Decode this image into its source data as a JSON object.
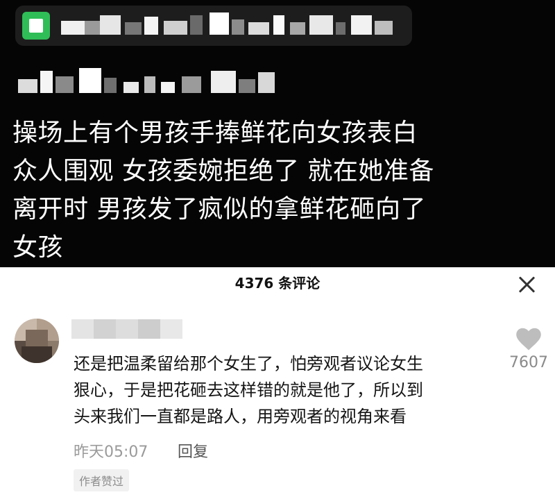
{
  "post": {
    "text_lines": [
      "操场上有个男孩手捧鲜花向女孩表白",
      "众人围观 女孩委婉拒绝了 就在她准备",
      "离开时 男孩发了疯似的拿鲜花砸向了",
      "女孩"
    ]
  },
  "comments_sheet": {
    "count_label": "4376 条评论",
    "comment": {
      "lines": [
        "还是把温柔留给那个女生了，怕旁观者议论女生",
        "狠心，于是把花砸去这样错的就是他了，所以到",
        "头来我们一直都是路人，用旁观者的视角来看"
      ],
      "time": "昨天05:07",
      "reply_label": "回复",
      "badge": "作者赞过",
      "like_count": "7607"
    }
  },
  "icons": {
    "close": "close-icon",
    "like": "heart-icon",
    "app": "app-logo-icon"
  },
  "colors": {
    "post_background": "#050505",
    "app_logo": "#2fbd57",
    "sheet_background": "#ffffff",
    "muted_text": "#9a9a9a"
  }
}
